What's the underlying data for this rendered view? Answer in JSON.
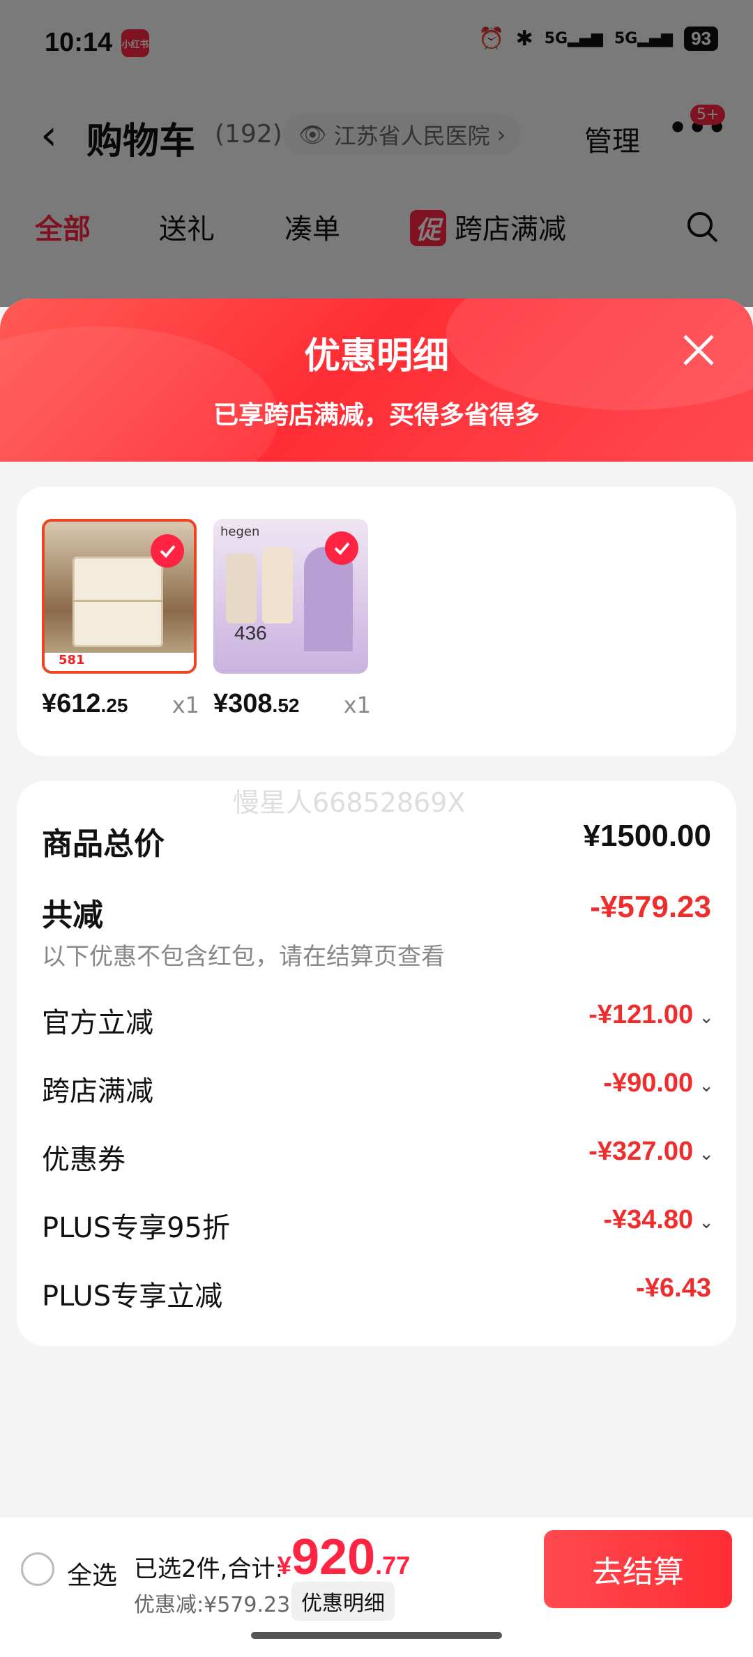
{
  "status_bar": {
    "time": "10:14",
    "app_icon_label": "小红书",
    "signal1": "5G",
    "signal2": "5G",
    "battery": "93"
  },
  "header": {
    "title": "购物车",
    "count": "(192)",
    "location": "江苏省人民医院",
    "manage": "管理",
    "badge": "5+"
  },
  "tabs": [
    {
      "label": "全部",
      "active": true
    },
    {
      "label": "送礼"
    },
    {
      "label": "凑单"
    },
    {
      "label": "跨店满减",
      "badge": "促"
    }
  ],
  "sheet": {
    "title": "优惠明细",
    "subtitle": "已享跨店满减，买得多省得多"
  },
  "products": [
    {
      "name": "bedside-cabinet",
      "price_int": "¥612",
      "price_dec": ".25",
      "qty": "x1",
      "promo_price": "581"
    },
    {
      "name": "hegen-bottle",
      "price_int": "¥308",
      "price_dec": ".52",
      "qty": "x1",
      "brand": "hegen",
      "promo_price": "436"
    }
  ],
  "summary": {
    "watermark": "慢星人66852869X",
    "total_label": "商品总价",
    "total_value": "¥1500.00",
    "reduce_label": "共减",
    "reduce_value": "-¥579.23",
    "note": "以下优惠不包含红包，请在结算页查看",
    "items": [
      {
        "label": "官方立减",
        "value": "-¥121.00",
        "expandable": true
      },
      {
        "label": "跨店满减",
        "value": "-¥90.00",
        "expandable": true
      },
      {
        "label": "优惠券",
        "value": "-¥327.00",
        "expandable": true
      },
      {
        "label": "PLUS专享95折",
        "value": "-¥34.80",
        "expandable": true
      },
      {
        "label": "PLUS专享立减",
        "value": "-¥6.43",
        "expandable": false
      }
    ]
  },
  "bottom": {
    "select_all": "全选",
    "selected": "已选2件,合计:",
    "currency": "¥",
    "total_int": "920",
    "total_dec": ".77",
    "discount": "优惠减:¥579.23",
    "detail_button": "优惠明细",
    "checkout": "去结算"
  },
  "colors": {
    "accent": "#ff2442",
    "discount_red": "#ef2d2d"
  }
}
